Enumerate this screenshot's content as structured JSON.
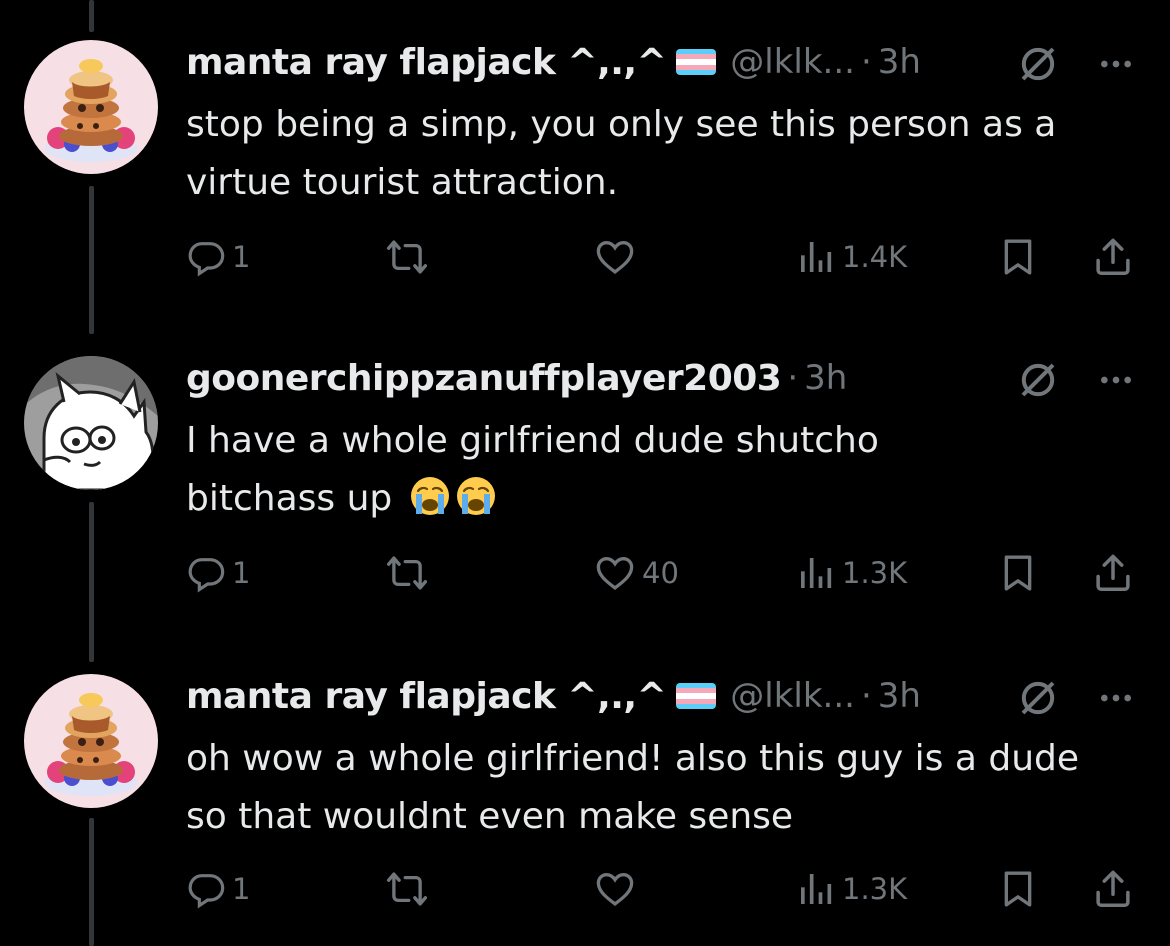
{
  "tweets": [
    {
      "name": "manta ray flapjack ^,.,^",
      "handle": "@lklk...",
      "time": "3h",
      "separator": "·",
      "text": "stop being a simp, you only see this person as a virtue tourist attraction.",
      "replies": "1",
      "retweets": "",
      "likes": "",
      "views": "1.4K",
      "flag_colors": [
        "#5bcefa",
        "#f5a9b8",
        "#ffffff",
        "#f5a9b8",
        "#5bcefa"
      ]
    },
    {
      "name": "goonerchippzanuffplayer2003",
      "handle": "",
      "time": "3h",
      "separator": "·",
      "text": "I have a whole girlfriend dude shutcho bitchass up",
      "emoji": [
        "loudly-crying-face",
        "loudly-crying-face"
      ],
      "replies": "1",
      "retweets": "",
      "likes": "40",
      "views": "1.3K"
    },
    {
      "name": "manta ray flapjack ^,.,^",
      "handle": "@lklk...",
      "time": "3h",
      "separator": "·",
      "text": "oh wow a whole girlfriend! also this guy is a dude so that wouldnt even make sense",
      "replies": "1",
      "retweets": "",
      "likes": "",
      "views": "1.3K"
    }
  ],
  "colors": {
    "background": "#000000",
    "text": "#e7e9ea",
    "muted": "#71767b",
    "thread_line": "#333639"
  },
  "icons": [
    "reply-icon",
    "retweet-icon",
    "like-icon",
    "views-icon",
    "bookmark-icon",
    "share-icon",
    "grok-icon",
    "more-icon"
  ]
}
